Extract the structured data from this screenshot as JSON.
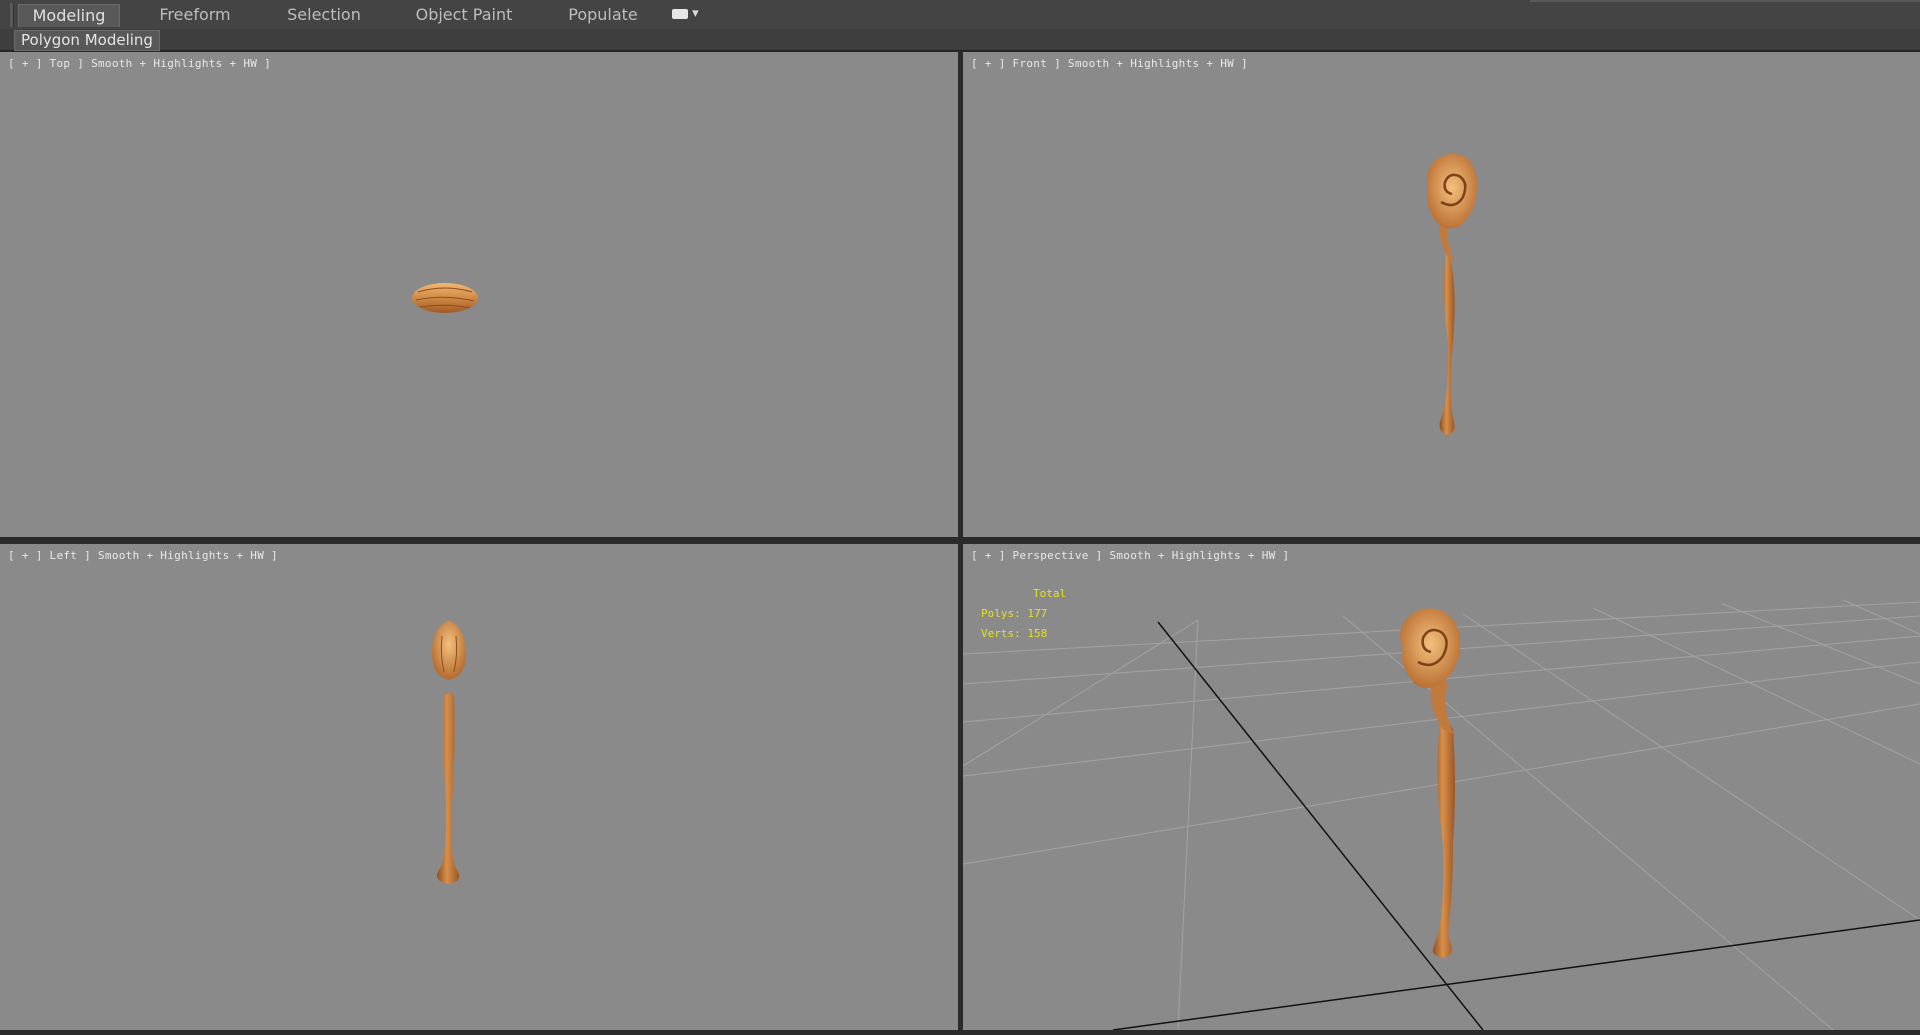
{
  "ribbon": {
    "tabs": [
      "Modeling",
      "Freeform",
      "Selection",
      "Object Paint",
      "Populate"
    ],
    "active_tab": "Modeling",
    "options_icon": "ribbon-options-icon",
    "sub_panel": "Polygon Modeling"
  },
  "viewports": {
    "top": "[ + ] Top ] Smooth + Highlights + HW ]",
    "front": "[ + ] Front ] Smooth + Highlights + HW ]",
    "left": "[ + ] Left ] Smooth + Highlights + HW ]",
    "perspective": "[ + ] Perspective ] Smooth + Highlights + HW ]"
  },
  "stats": {
    "header": "Total",
    "polys": "Polys: 177",
    "verts": "Verts: 158"
  },
  "colors": {
    "viewport_bg": "#8a8a8a",
    "wood": "#c77a3a",
    "stats_text": "#e8e020"
  }
}
